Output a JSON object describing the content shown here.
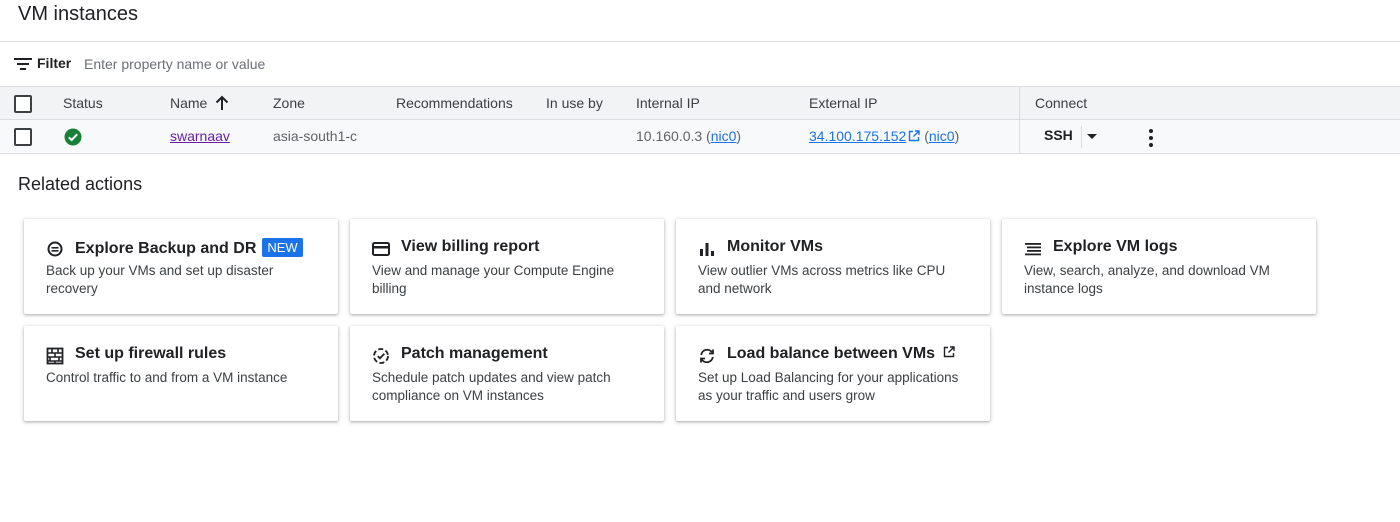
{
  "page": {
    "title": "VM instances"
  },
  "filter": {
    "label": "Filter",
    "placeholder": "Enter property name or value"
  },
  "table": {
    "columns": {
      "status": "Status",
      "name": "Name",
      "zone": "Zone",
      "recommendations": "Recommendations",
      "in_use_by": "In use by",
      "internal_ip": "Internal IP",
      "external_ip": "External IP",
      "connect": "Connect"
    },
    "rows": [
      {
        "status_icon": "check-circle-icon",
        "status_color": "#188038",
        "name": "swarnaav",
        "zone": "asia-south1-c",
        "recommendations": "",
        "in_use_by": "",
        "internal_ip": "10.160.0.3",
        "internal_nic": "nic0",
        "external_ip": "34.100.175.152",
        "external_nic": "nic0",
        "connect": "SSH"
      }
    ]
  },
  "related": {
    "title": "Related actions",
    "cards": [
      {
        "icon": "backup-icon",
        "title": "Explore Backup and DR",
        "badge": "NEW",
        "desc": "Back up your VMs and set up disaster recovery"
      },
      {
        "icon": "billing-card-icon",
        "title": "View billing report",
        "desc": "View and manage your Compute Engine billing"
      },
      {
        "icon": "bar-chart-icon",
        "title": "Monitor VMs",
        "desc": "View outlier VMs across metrics like CPU and network"
      },
      {
        "icon": "logs-list-icon",
        "title": "Explore VM logs",
        "desc": "View, search, analyze, and download VM instance logs"
      },
      {
        "icon": "firewall-icon",
        "title": "Set up firewall rules",
        "desc": "Control traffic to and from a VM instance"
      },
      {
        "icon": "patch-icon",
        "title": "Patch management",
        "desc": "Schedule patch updates and view patch compliance on VM instances"
      },
      {
        "icon": "load-balance-icon",
        "title": "Load balance between VMs",
        "desc": "Set up Load Balancing for your applications as your traffic and users grow"
      }
    ]
  },
  "colors": {
    "link": "#1a73e8",
    "visited_link": "#681da8",
    "badge": "#1a73e8",
    "status_ok": "#188038"
  }
}
